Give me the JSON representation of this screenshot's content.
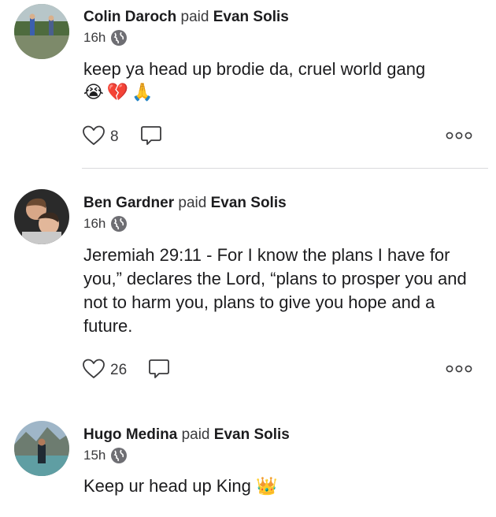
{
  "posts": [
    {
      "author": "Colin Daroch",
      "action": "paid",
      "recipient": "Evan Solis",
      "time": "16h",
      "message": "keep ya head up brodie da, cruel world gang",
      "emojis": "😭💔🙏",
      "likes": "8"
    },
    {
      "author": "Ben Gardner",
      "action": "paid",
      "recipient": "Evan Solis",
      "time": "16h",
      "message": "Jeremiah 29:11 - For I know the plans I have for you,” declares the Lord, “plans to prosper you and not to harm you, plans to give you hope and a future.",
      "likes": "26"
    },
    {
      "author": "Hugo Medina",
      "action": "paid",
      "recipient": "Evan Solis",
      "time": "15h",
      "message": "Keep ur head up King",
      "emojis": "👑"
    }
  ],
  "icons": {
    "globe": "globe-icon",
    "like": "heart-icon",
    "comment": "comment-bubble-icon",
    "more": "more-dots-icon"
  },
  "colors": {
    "text": "#1c1c1e",
    "muted": "#3a3a3c",
    "divider": "#d9d9dc"
  }
}
